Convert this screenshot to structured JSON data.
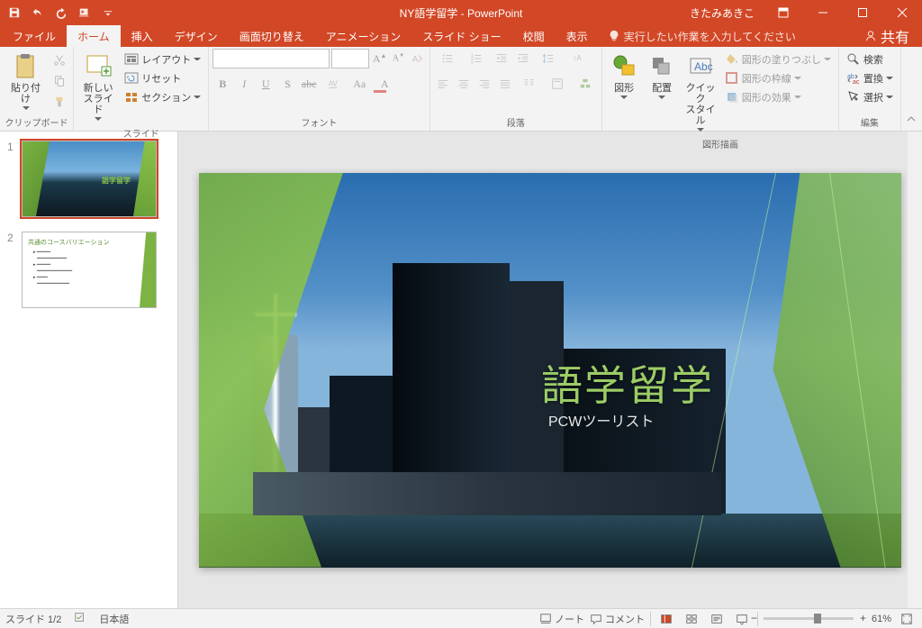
{
  "titlebar": {
    "doc_title": "NY語学留学 - PowerPoint",
    "user": "きたみあきこ"
  },
  "tabs": {
    "file": "ファイル",
    "home": "ホーム",
    "insert": "挿入",
    "design": "デザイン",
    "transitions": "画面切り替え",
    "animations": "アニメーション",
    "slideshow": "スライド ショー",
    "review": "校閲",
    "view": "表示",
    "tellme": "実行したい作業を入力してください",
    "share": "共有"
  },
  "ribbon": {
    "clipboard": {
      "paste": "貼り付け",
      "label": "クリップボード"
    },
    "slides": {
      "new_slide": "新しい\nスライド",
      "layout": "レイアウト",
      "reset": "リセット",
      "section": "セクション",
      "label": "スライド"
    },
    "font": {
      "label": "フォント"
    },
    "paragraph": {
      "label": "段落"
    },
    "drawing": {
      "shapes": "図形",
      "arrange": "配置",
      "quick_styles": "クイック\nスタイル",
      "fill": "図形の塗りつぶし",
      "outline": "図形の枠線",
      "effects": "図形の効果",
      "label": "図形描画"
    },
    "editing": {
      "find": "検索",
      "replace": "置換",
      "select": "選択",
      "label": "編集"
    }
  },
  "thumbnails": {
    "n1": "1",
    "n2": "2",
    "slide2_title": "共通のコースバリエーション",
    "slide1_mini_title": "語学留学"
  },
  "slide": {
    "title": "語学留学",
    "subtitle": "PCWツーリスト"
  },
  "status": {
    "slide_counter": "スライド 1/2",
    "language": "日本語",
    "notes": "ノート",
    "comments": "コメント",
    "zoom": "61%"
  }
}
